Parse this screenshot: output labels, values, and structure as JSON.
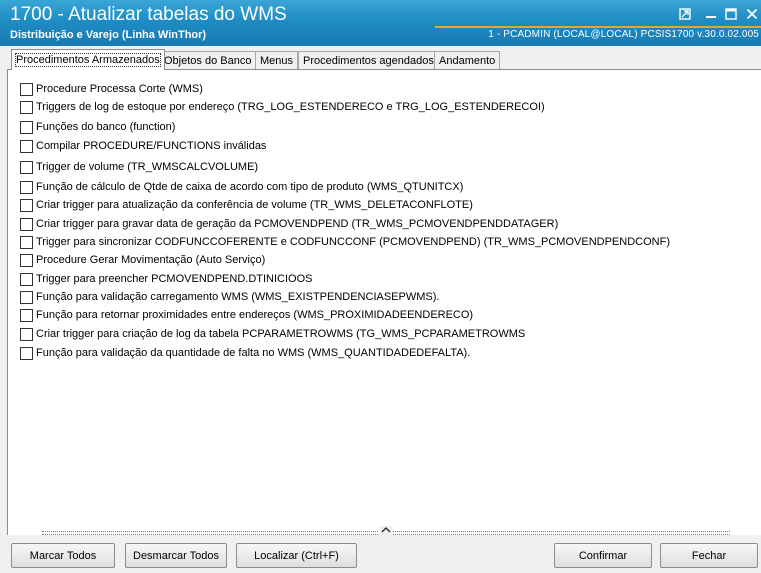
{
  "window": {
    "title": "1700 - Atualizar tabelas do WMS",
    "subtitle": "Distribuição e Varejo (Linha WinThor)",
    "status": "1 - PCADMIN (LOCAL@LOCAL)   PCSIS1700  v.30.0.02.005",
    "controls": [
      "pin-icon",
      "minimize-icon",
      "maximize-icon",
      "close-icon"
    ]
  },
  "tabs": [
    {
      "label": "Procedimentos Armazenados",
      "active": true
    },
    {
      "label": "Objetos do Banco",
      "active": false
    },
    {
      "label": "Menus",
      "active": false
    },
    {
      "label": "Procedimentos agendados",
      "active": false
    },
    {
      "label": "Andamento",
      "active": false
    }
  ],
  "items": [
    {
      "label": "Procedure Processa Corte (WMS)",
      "checked": false
    },
    {
      "label": "Triggers de log de estoque por endereço (TRG_LOG_ESTENDERECO e TRG_LOG_ESTENDERECOI)",
      "checked": false
    },
    {
      "label": "Funções do banco (function)",
      "checked": false
    },
    {
      "label": "Compilar PROCEDURE/FUNCTIONS inválidas",
      "checked": false
    },
    {
      "label": "Trigger de volume (TR_WMSCALCVOLUME)",
      "checked": false
    },
    {
      "label": "Função de cálculo de Qtde de caixa de acordo com tipo de produto (WMS_QTUNITCX)",
      "checked": false
    },
    {
      "label": "Criar trigger para atualização da conferência de volume (TR_WMS_DELETACONFLOTE)",
      "checked": false
    },
    {
      "label": "Criar trigger para gravar data de geração da PCMOVENDPEND (TR_WMS_PCMOVENDPENDDATAGER)",
      "checked": false
    },
    {
      "label": "Trigger para sincronizar CODFUNCCOFERENTE e CODFUNCCONF (PCMOVENDPEND) (TR_WMS_PCMOVENDPENDCONF)",
      "checked": false
    },
    {
      "label": "Procedure Gerar Movimentação (Auto Serviço)",
      "checked": false
    },
    {
      "label": "Trigger para preencher PCMOVENDPEND.DTINICIOOS",
      "checked": false
    },
    {
      "label": "Função para validação carregamento WMS (WMS_EXISTPENDENCIASEPWMS).",
      "checked": false
    },
    {
      "label": "Função para retornar proximidades entre endereços (WMS_PROXIMIDADEENDERECO)",
      "checked": false
    },
    {
      "label": "Criar trigger para criação de log da tabela PCPARAMETROWMS (TG_WMS_PCPARAMETROWMS",
      "checked": false
    },
    {
      "label": "Função para validação da quantidade de falta no WMS (WMS_QUANTIDADEDEFALTA).",
      "checked": false
    }
  ],
  "buttons": {
    "marcar": "Marcar Todos",
    "desmarcar": "Desmarcar Todos",
    "localizar": "Localizar (Ctrl+F)",
    "confirmar": "Confirmar",
    "fechar": "Fechar"
  },
  "splitter_icon": "chevron-up-icon"
}
